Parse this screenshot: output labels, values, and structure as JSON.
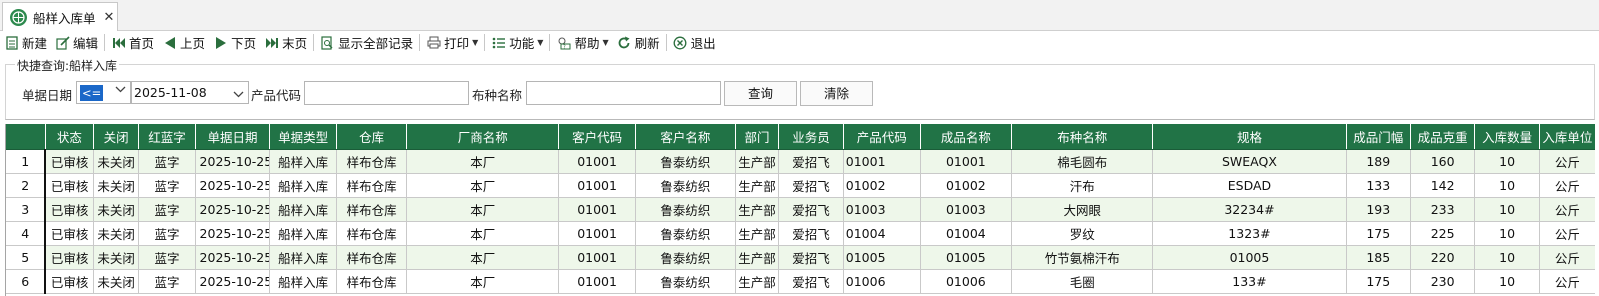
{
  "tab": {
    "title": "船样入库单",
    "icon": "globe-grid-icon"
  },
  "toolbar": {
    "items": [
      {
        "label": "新建",
        "icon": "document-icon"
      },
      {
        "label": "编辑",
        "icon": "edit-icon"
      },
      {
        "label": "首页",
        "icon": "first-page-icon"
      },
      {
        "label": "上页",
        "icon": "prev-page-icon"
      },
      {
        "label": "下页",
        "icon": "next-page-icon"
      },
      {
        "label": "末页",
        "icon": "last-page-icon"
      },
      {
        "label": "显示全部记录",
        "icon": "search-doc-icon"
      },
      {
        "label": "打印",
        "icon": "printer-icon"
      },
      {
        "label": "功能",
        "icon": "list-icon"
      },
      {
        "label": "帮助",
        "icon": "help-icon"
      },
      {
        "label": "刷新",
        "icon": "refresh-icon"
      },
      {
        "label": "退出",
        "icon": "exit-icon"
      }
    ]
  },
  "query": {
    "legend": "快捷查询:船样入库",
    "date_label": "单据日期",
    "operator": "<=",
    "date_value": "2025-11-08",
    "product_code_label": "产品代码",
    "product_code_value": "",
    "fabric_label": "布种名称",
    "fabric_value": "",
    "search_button": "查询",
    "clear_button": "清除"
  },
  "grid": {
    "columns": [
      "",
      "状态",
      "关闭",
      "红蓝字",
      "单据日期",
      "单据类型",
      "仓库",
      "厂商名称",
      "客户代码",
      "客户名称",
      "部门",
      "业务员",
      "产品代码",
      "成品名称",
      "布种名称",
      "规格",
      "成品门幅",
      "成品克重",
      "入库数量",
      "入库单位"
    ],
    "rows": [
      [
        "1",
        "已审核",
        "未关闭",
        "蓝字",
        "2025-10-25",
        "船样入库",
        "样布仓库",
        "本厂",
        "01001",
        "鲁泰纺织",
        "生产部",
        "爱招飞",
        "01001",
        "01001",
        "棉毛圆布",
        "SWEAQX",
        "189",
        "160",
        "10",
        "公斤"
      ],
      [
        "2",
        "已审核",
        "未关闭",
        "蓝字",
        "2025-10-25",
        "船样入库",
        "样布仓库",
        "本厂",
        "01001",
        "鲁泰纺织",
        "生产部",
        "爱招飞",
        "01002",
        "01002",
        "汗布",
        "ESDAD",
        "133",
        "142",
        "10",
        "公斤"
      ],
      [
        "3",
        "已审核",
        "未关闭",
        "蓝字",
        "2025-10-25",
        "船样入库",
        "样布仓库",
        "本厂",
        "01001",
        "鲁泰纺织",
        "生产部",
        "爱招飞",
        "01003",
        "01003",
        "大网眼",
        "32234#",
        "193",
        "233",
        "10",
        "公斤"
      ],
      [
        "4",
        "已审核",
        "未关闭",
        "蓝字",
        "2025-10-25",
        "船样入库",
        "样布仓库",
        "本厂",
        "01001",
        "鲁泰纺织",
        "生产部",
        "爱招飞",
        "01004",
        "01004",
        "罗纹",
        "1323#",
        "175",
        "225",
        "10",
        "公斤"
      ],
      [
        "5",
        "已审核",
        "未关闭",
        "蓝字",
        "2025-10-25",
        "船样入库",
        "样布仓库",
        "本厂",
        "01001",
        "鲁泰纺织",
        "生产部",
        "爱招飞",
        "01005",
        "01005",
        "竹节氨棉汗布",
        "01005",
        "185",
        "220",
        "10",
        "公斤"
      ],
      [
        "6",
        "已审核",
        "未关闭",
        "蓝字",
        "2025-10-25",
        "船样入库",
        "样布仓库",
        "本厂",
        "01001",
        "鲁泰纺织",
        "生产部",
        "爱招飞",
        "01006",
        "01006",
        "毛圈",
        "133#",
        "175",
        "230",
        "10",
        "公斤"
      ]
    ]
  },
  "colors": {
    "header_bg": "#217346",
    "row_alt_bg": "#eef7ea",
    "selection": "#1a67c8"
  }
}
